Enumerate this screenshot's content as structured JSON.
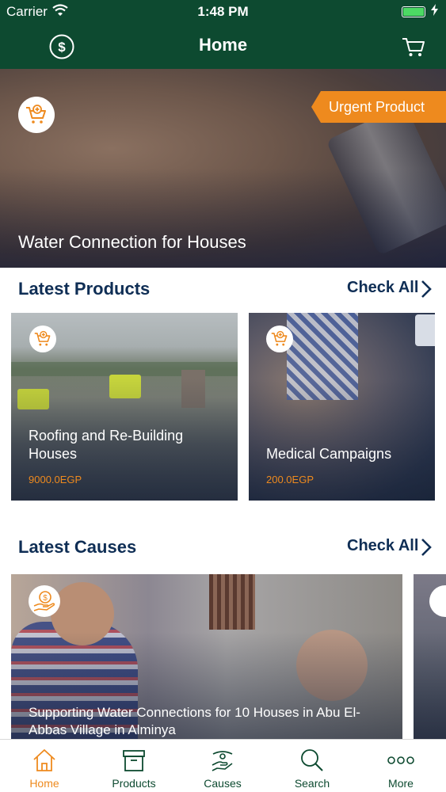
{
  "status_bar": {
    "carrier": "Carrier",
    "time": "1:48 PM",
    "battery_level": 1.0
  },
  "nav": {
    "title": "Home",
    "left_icon": "dollar-circle-icon",
    "right_icon": "cart-icon"
  },
  "hero": {
    "badge": "Urgent Product",
    "title": "Water Connection for Houses",
    "icon": "add-to-cart-icon"
  },
  "latest_products": {
    "title": "Latest Products",
    "check_all": "Check All",
    "items": [
      {
        "title": "Roofing and Re-Building Houses",
        "price": "9000.0EGP"
      },
      {
        "title": "Medical Campaigns",
        "price": "200.0EGP"
      }
    ]
  },
  "latest_causes": {
    "title": "Latest Causes",
    "check_all": "Check All",
    "items": [
      {
        "title": "Supporting Water Connections for 10 Houses in Abu El-Abbas Village in Alminya"
      }
    ]
  },
  "tabs": [
    {
      "label": "Home",
      "icon": "home-icon",
      "active": true
    },
    {
      "label": "Products",
      "icon": "box-icon",
      "active": false
    },
    {
      "label": "Causes",
      "icon": "hand-icon",
      "active": false
    },
    {
      "label": "Search",
      "icon": "search-icon",
      "active": false
    },
    {
      "label": "More",
      "icon": "more-icon",
      "active": false
    }
  ],
  "colors": {
    "primary": "#0d4a30",
    "accent": "#ee8a1e",
    "heading": "#0f2e55"
  }
}
